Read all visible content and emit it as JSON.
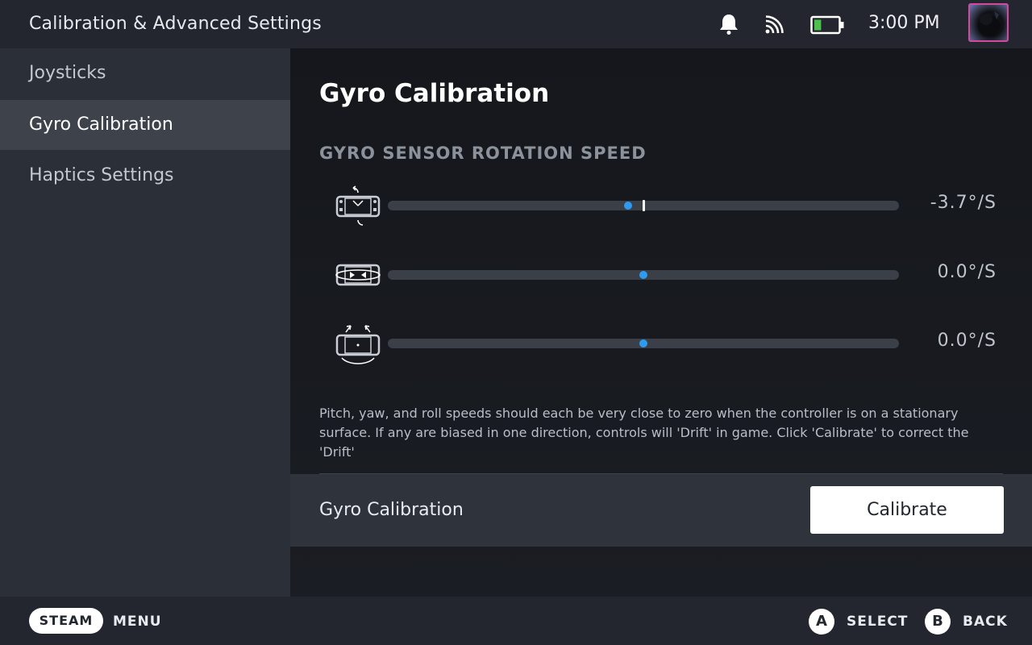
{
  "header": {
    "title": "Calibration & Advanced Settings",
    "time": "3:00 PM",
    "icons": [
      "bell-icon",
      "wifi-icon",
      "battery-icon"
    ],
    "battery_level": 0.3,
    "battery_color": "#4cc24a",
    "avatar_border_color": "#d24aa0"
  },
  "sidebar": {
    "items": [
      {
        "label": "Joysticks",
        "active": false
      },
      {
        "label": "Gyro Calibration",
        "active": true
      },
      {
        "label": "Haptics Settings",
        "active": false
      }
    ]
  },
  "main": {
    "title": "Gyro Calibration",
    "section_label": "GYRO SENSOR ROTATION SPEED",
    "accent_color": "#2e9bf0",
    "axes": [
      {
        "icon": "pitch-rotation-icon",
        "value": "-3.7°/S",
        "level": 0.47
      },
      {
        "icon": "yaw-rotation-icon",
        "value": "0.0°/S",
        "level": 0.5
      },
      {
        "icon": "roll-rotation-icon",
        "value": "0.0°/S",
        "level": 0.5
      }
    ],
    "help_text": "Pitch, yaw, and roll speeds should each be very close to zero when the controller is on a stationary surface. If any are biased in one direction, controls will 'Drift' in game. Click 'Calibrate' to correct the 'Drift'",
    "calibration_row_label": "Gyro Calibration",
    "calibrate_button": "Calibrate"
  },
  "footer": {
    "steam_label": "STEAM",
    "menu_label": "MENU",
    "a_button": "A",
    "select_label": "SELECT",
    "b_button": "B",
    "back_label": "BACK"
  }
}
